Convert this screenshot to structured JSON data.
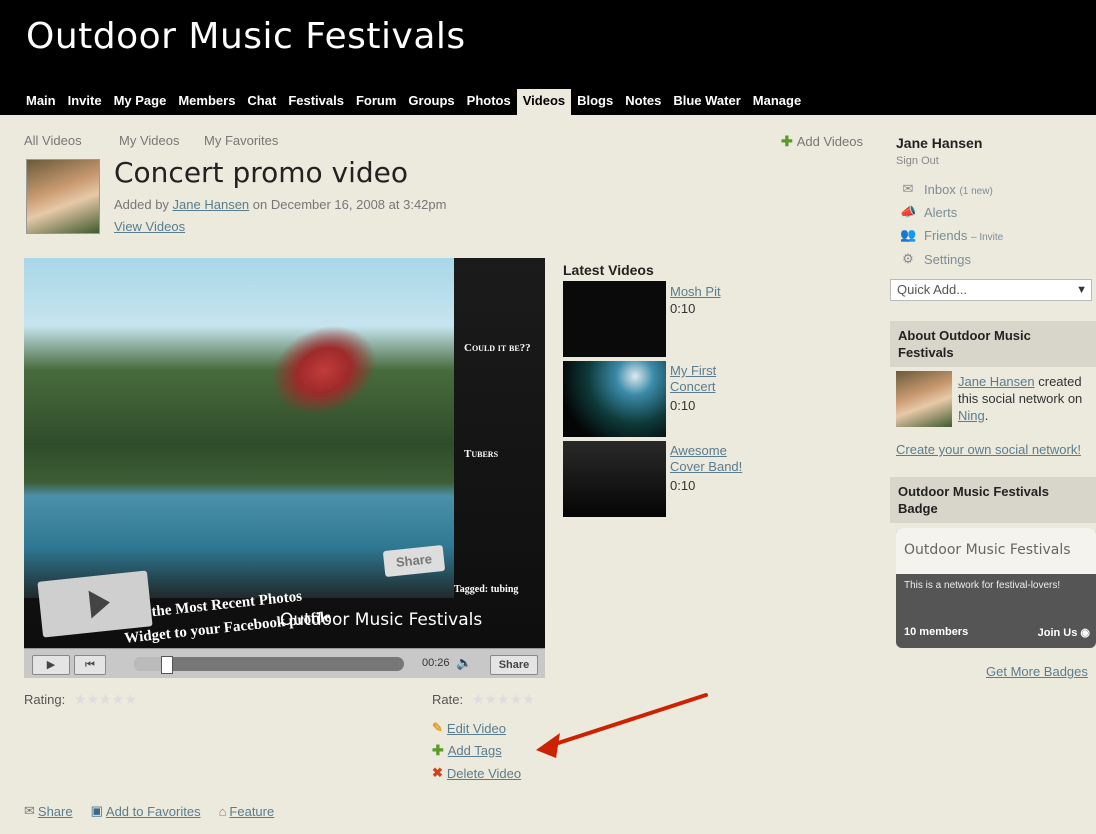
{
  "site": {
    "title": "Outdoor Music Festivals"
  },
  "nav": {
    "tabs": [
      {
        "label": "Main"
      },
      {
        "label": "Invite"
      },
      {
        "label": "My Page"
      },
      {
        "label": "Members"
      },
      {
        "label": "Chat"
      },
      {
        "label": "Festivals"
      },
      {
        "label": "Forum"
      },
      {
        "label": "Groups"
      },
      {
        "label": "Photos"
      },
      {
        "label": "Videos"
      },
      {
        "label": "Blogs"
      },
      {
        "label": "Notes"
      },
      {
        "label": "Blue Water"
      },
      {
        "label": "Manage"
      }
    ],
    "active": "Videos"
  },
  "subnav": {
    "all": "All Videos",
    "mine": "My Videos",
    "favorites": "My Favorites",
    "add": "Add Videos"
  },
  "video": {
    "title": "Concert promo video",
    "added_prefix": "Added by ",
    "author": "Jane Hansen",
    "added_suffix": " on December 16, 2008 at 3:42pm",
    "view_videos": "View Videos",
    "watermark": "Outdoor Music Festivals",
    "share_overlay": "Share",
    "time": "00:26",
    "share_button": "Share",
    "progress": 0.12,
    "overlay": {
      "could": "Could it be??",
      "tubers": "Tubers",
      "tagged": "Tagged: tubing",
      "photos_line1": "Add the Most Recent Photos",
      "photos_line2": "Widget to your Facebook profile"
    }
  },
  "rating": {
    "label": "Rating:",
    "rate_label": "Rate:",
    "stars": "★★★★★"
  },
  "actions": {
    "edit": "Edit Video",
    "add_tags": "Add Tags",
    "delete": "Delete Video"
  },
  "bottom": {
    "share": "Share",
    "favorites": "Add to Favorites",
    "feature": "Feature"
  },
  "latest": {
    "title": "Latest Videos",
    "items": [
      {
        "title": "Mosh Pit",
        "duration": "0:10"
      },
      {
        "title": "My First Concert",
        "duration": "0:10"
      },
      {
        "title": "Awesome Cover Band!",
        "duration": "0:10"
      }
    ]
  },
  "sidebar": {
    "user": "Jane Hansen",
    "sign_out": "Sign Out",
    "inbox": "Inbox",
    "inbox_count": "(1 new)",
    "alerts": "Alerts",
    "friends": "Friends",
    "invite": "– Invite",
    "settings": "Settings",
    "quick_add": "Quick Add...",
    "about_header": "About Outdoor Music Festivals",
    "about_author": "Jane Hansen",
    "about_text": " created this social network on ",
    "about_ning": "Ning",
    "create_own": "Create your own social network!",
    "badge_header": "Outdoor Music Festivals Badge",
    "badge_title": "Outdoor Music Festivals",
    "badge_desc": "This is a network for festival-lovers!",
    "badge_members": "10 members",
    "badge_join": "Join Us",
    "more_badges": "Get More Badges"
  },
  "colors": {
    "background": "#ece9dd",
    "header": "#000000",
    "link": "#5a7d8e",
    "arrow": "#cc2200"
  }
}
